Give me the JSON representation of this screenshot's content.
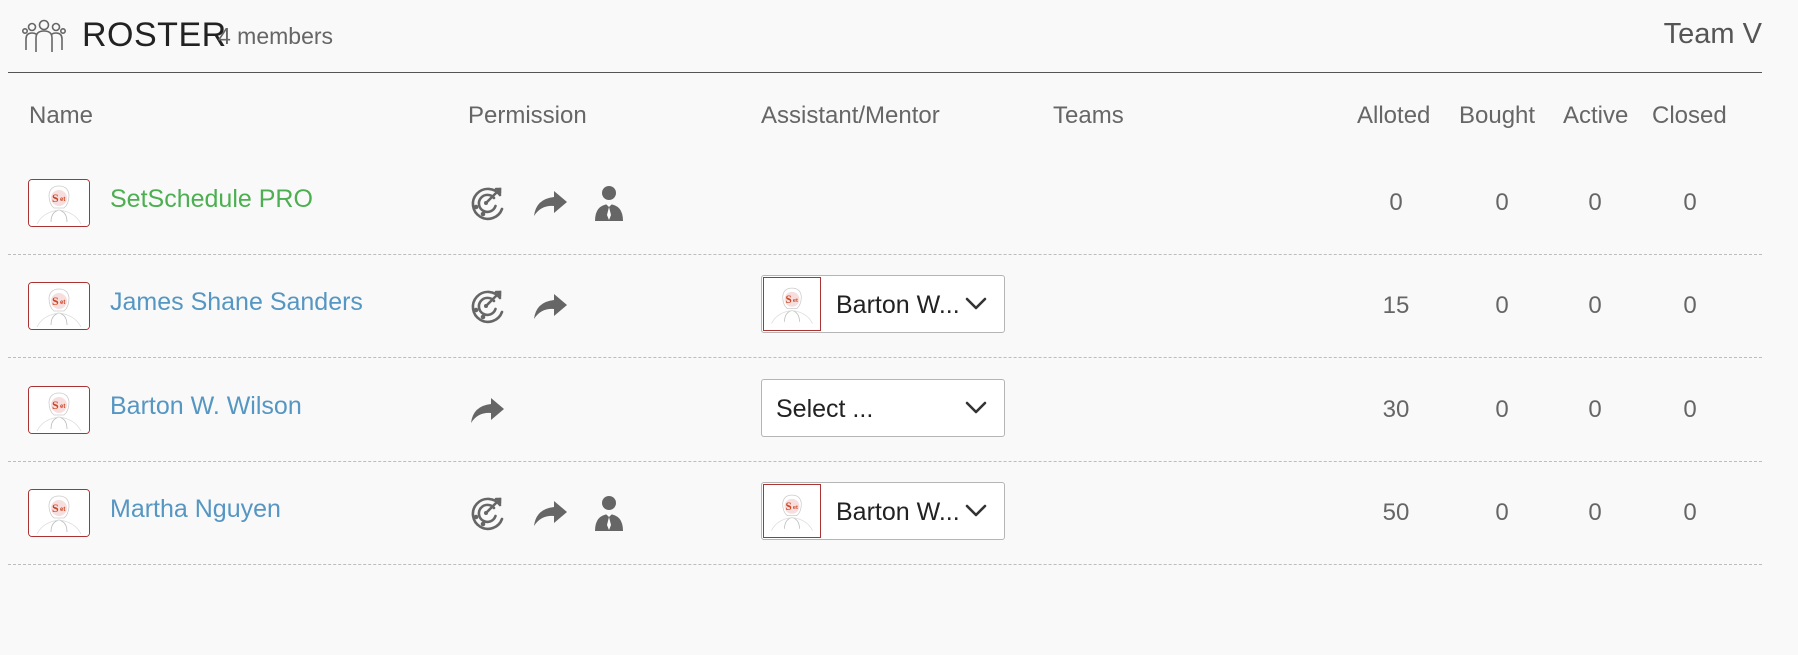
{
  "header": {
    "title": "ROSTER",
    "member_count": "4 members",
    "team_name": "Team V"
  },
  "columns": {
    "name": "Name",
    "permission": "Permission",
    "mentor": "Assistant/Mentor",
    "teams": "Teams",
    "alloted": "Alloted",
    "bought": "Bought",
    "active": "Active",
    "closed": "Closed"
  },
  "rows": [
    {
      "name": "SetSchedule PRO",
      "name_color": "#4caf50",
      "permissions": [
        "target-icon",
        "share-icon",
        "manager-icon"
      ],
      "mentor": null,
      "alloted": "0",
      "bought": "0",
      "active": "0",
      "closed": "0"
    },
    {
      "name": "James Shane Sanders",
      "name_color": "#5596c2",
      "permissions": [
        "target-icon",
        "share-icon"
      ],
      "mentor": {
        "label": "Barton W...",
        "has_avatar": true
      },
      "alloted": "15",
      "bought": "0",
      "active": "0",
      "closed": "0"
    },
    {
      "name": "Barton W. Wilson",
      "name_color": "#5596c2",
      "permissions": [
        "share-icon"
      ],
      "mentor": {
        "label": "Select ...",
        "has_avatar": false
      },
      "alloted": "30",
      "bought": "0",
      "active": "0",
      "closed": "0"
    },
    {
      "name": "Martha Nguyen",
      "name_color": "#5596c2",
      "permissions": [
        "target-icon",
        "share-icon",
        "manager-icon"
      ],
      "mentor": {
        "label": "Barton W...",
        "has_avatar": true
      },
      "alloted": "50",
      "bought": "0",
      "active": "0",
      "closed": "0"
    }
  ],
  "colors": {
    "accent_link": "#5596c2",
    "pro_green": "#4caf50",
    "avatar_border": "#aa3333",
    "icon_gray": "#666666"
  }
}
